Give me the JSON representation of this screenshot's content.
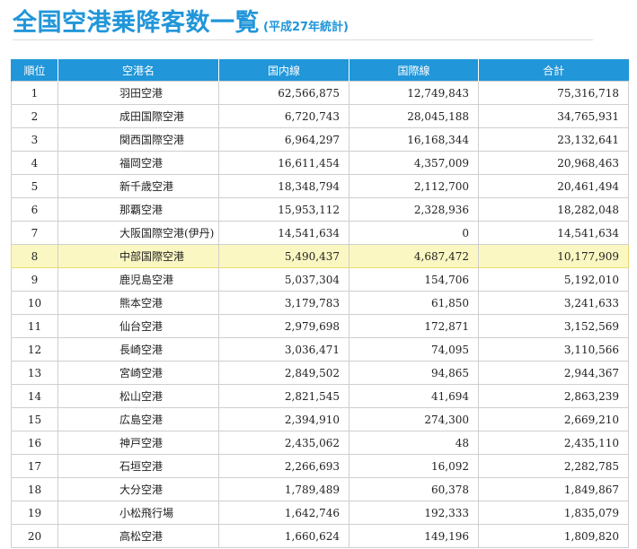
{
  "header": {
    "title": "全国空港乗降客数一覧",
    "subtitle": "(平成27年統計)"
  },
  "table": {
    "columns": [
      "順位",
      "空港名",
      "国内線",
      "国際線",
      "合計"
    ],
    "highlight_rank": "8",
    "highlight_color": "#fbf7c2",
    "header_color": "#2196d9",
    "rows": [
      {
        "rank": "1",
        "name": "羽田空港",
        "domestic": "62,566,875",
        "international": "12,749,843",
        "total": "75,316,718"
      },
      {
        "rank": "2",
        "name": "成田国際空港",
        "domestic": "6,720,743",
        "international": "28,045,188",
        "total": "34,765,931"
      },
      {
        "rank": "3",
        "name": "関西国際空港",
        "domestic": "6,964,297",
        "international": "16,168,344",
        "total": "23,132,641"
      },
      {
        "rank": "4",
        "name": "福岡空港",
        "domestic": "16,611,454",
        "international": "4,357,009",
        "total": "20,968,463"
      },
      {
        "rank": "5",
        "name": "新千歳空港",
        "domestic": "18,348,794",
        "international": "2,112,700",
        "total": "20,461,494"
      },
      {
        "rank": "6",
        "name": "那覇空港",
        "domestic": "15,953,112",
        "international": "2,328,936",
        "total": "18,282,048"
      },
      {
        "rank": "7",
        "name": "大阪国際空港(伊丹)",
        "domestic": "14,541,634",
        "international": "0",
        "total": "14,541,634"
      },
      {
        "rank": "8",
        "name": "中部国際空港",
        "domestic": "5,490,437",
        "international": "4,687,472",
        "total": "10,177,909"
      },
      {
        "rank": "9",
        "name": "鹿児島空港",
        "domestic": "5,037,304",
        "international": "154,706",
        "total": "5,192,010"
      },
      {
        "rank": "10",
        "name": "熊本空港",
        "domestic": "3,179,783",
        "international": "61,850",
        "total": "3,241,633"
      },
      {
        "rank": "11",
        "name": "仙台空港",
        "domestic": "2,979,698",
        "international": "172,871",
        "total": "3,152,569"
      },
      {
        "rank": "12",
        "name": "長崎空港",
        "domestic": "3,036,471",
        "international": "74,095",
        "total": "3,110,566"
      },
      {
        "rank": "13",
        "name": "宮崎空港",
        "domestic": "2,849,502",
        "international": "94,865",
        "total": "2,944,367"
      },
      {
        "rank": "14",
        "name": "松山空港",
        "domestic": "2,821,545",
        "international": "41,694",
        "total": "2,863,239"
      },
      {
        "rank": "15",
        "name": "広島空港",
        "domestic": "2,394,910",
        "international": "274,300",
        "total": "2,669,210"
      },
      {
        "rank": "16",
        "name": "神戸空港",
        "domestic": "2,435,062",
        "international": "48",
        "total": "2,435,110"
      },
      {
        "rank": "17",
        "name": "石垣空港",
        "domestic": "2,266,693",
        "international": "16,092",
        "total": "2,282,785"
      },
      {
        "rank": "18",
        "name": "大分空港",
        "domestic": "1,789,489",
        "international": "60,378",
        "total": "1,849,867"
      },
      {
        "rank": "19",
        "name": "小松飛行場",
        "domestic": "1,642,746",
        "international": "192,333",
        "total": "1,835,079"
      },
      {
        "rank": "20",
        "name": "高松空港",
        "domestic": "1,660,624",
        "international": "149,196",
        "total": "1,809,820"
      }
    ]
  }
}
